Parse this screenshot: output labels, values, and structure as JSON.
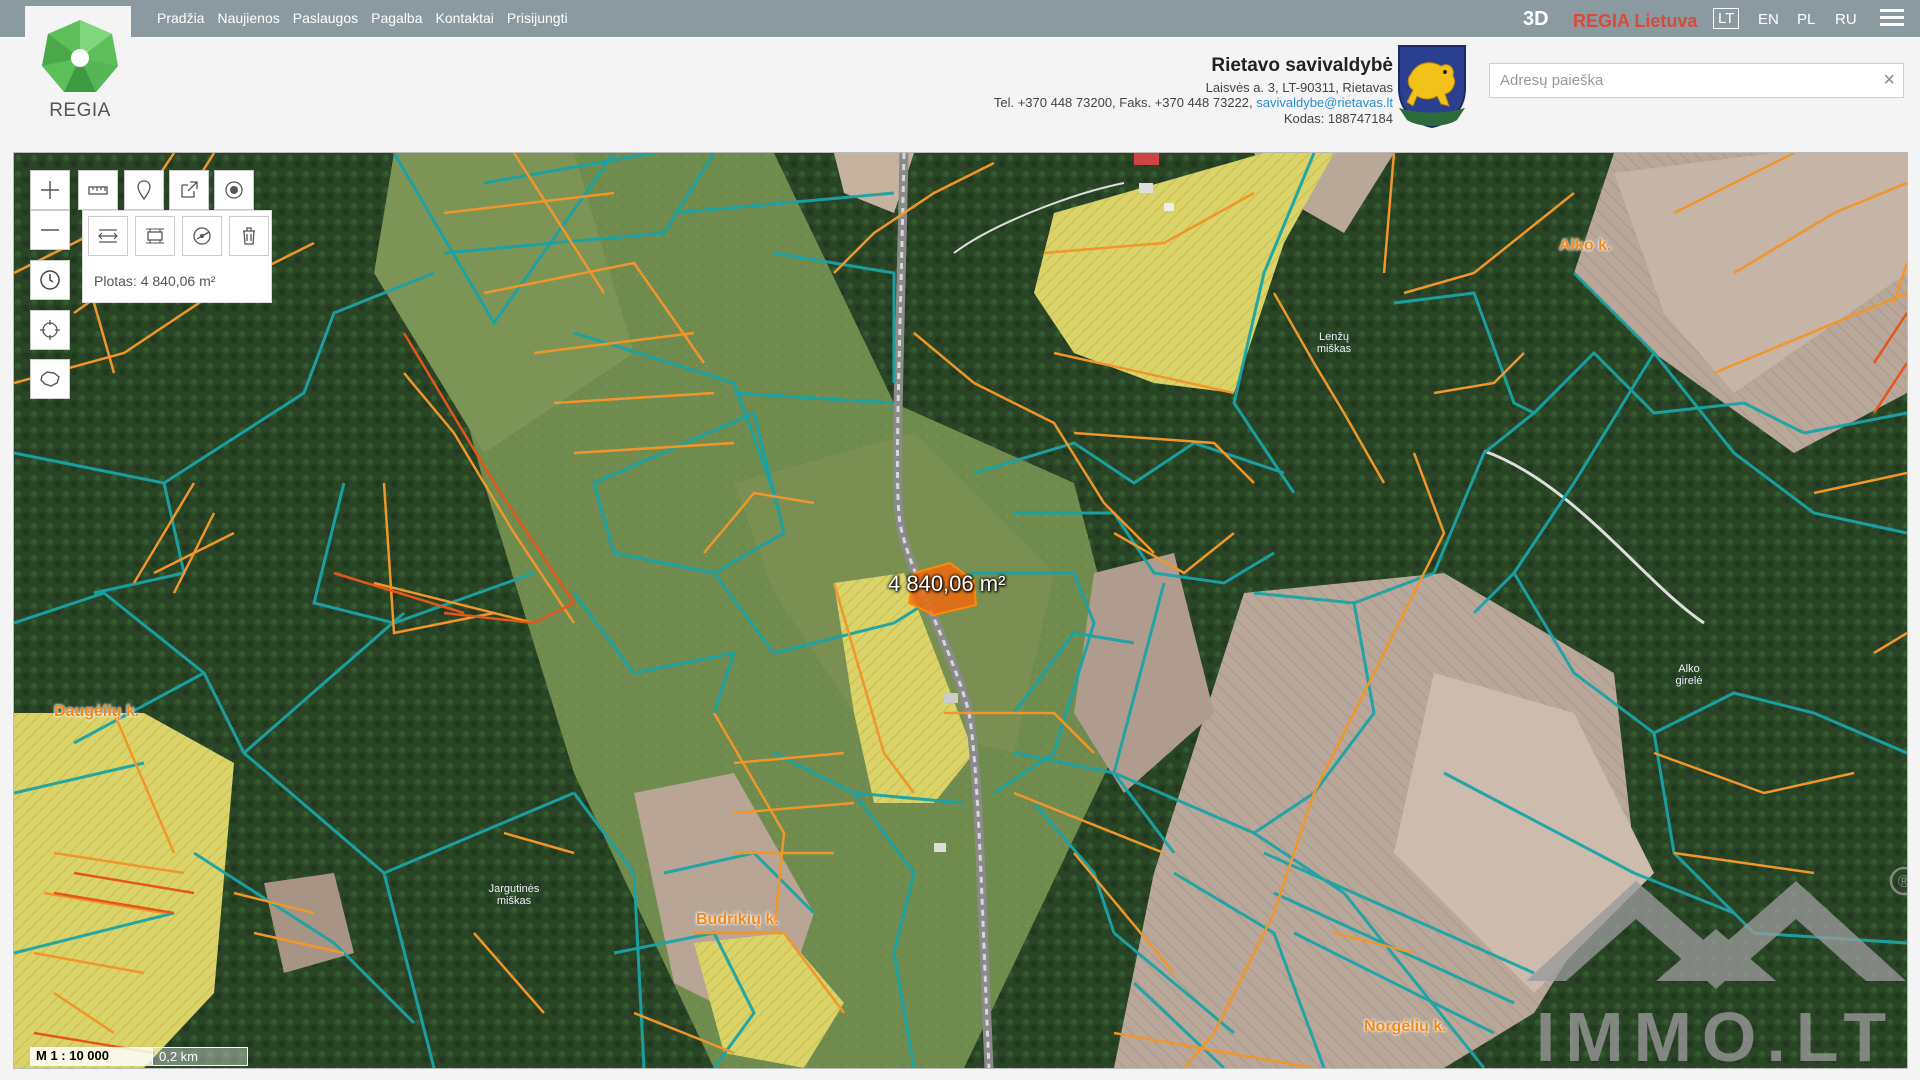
{
  "nav": {
    "items": [
      "Pradžia",
      "Naujienos",
      "Paslaugos",
      "Pagalba",
      "Kontaktai",
      "Prisijungti"
    ],
    "view_3d": "3D",
    "brand": "REGIA Lietuva",
    "languages": [
      "LT",
      "EN",
      "PL",
      "RU"
    ],
    "active_language": "LT"
  },
  "logo": {
    "text": "REGIA"
  },
  "municipality": {
    "name": "Rietavo savivaldybė",
    "address": "Laisvės a. 3, LT-90311, Rietavas",
    "phone": "Tel. +370 448 73200, Faks. +370 448 73222, ",
    "email": "savivaldybe@rietavas.lt",
    "code": "Kodas: 188747184"
  },
  "search": {
    "placeholder": "Adresų paieška",
    "value": "",
    "clear": "×"
  },
  "map": {
    "area_label": "4 840,06 m²",
    "measure_info": "Plotas: 4 840,06 m²",
    "places": [
      "Alko k.",
      "Daugėlių k.",
      "Budrikių k.",
      "Norgėlių k."
    ],
    "forests": [
      "Lenžų miškas",
      "Alko girelė",
      "Jargutinės miškas"
    ],
    "scale_ratio": "M 1 : 10 000",
    "scale_km": "0,2 km",
    "watermark": "IMMO.LT",
    "registered": "®"
  },
  "colors": {
    "topbar": "#8b9aa1",
    "orange": "#f0962a",
    "teal": "#1aa3a6",
    "brand_red": "#d94a38"
  }
}
